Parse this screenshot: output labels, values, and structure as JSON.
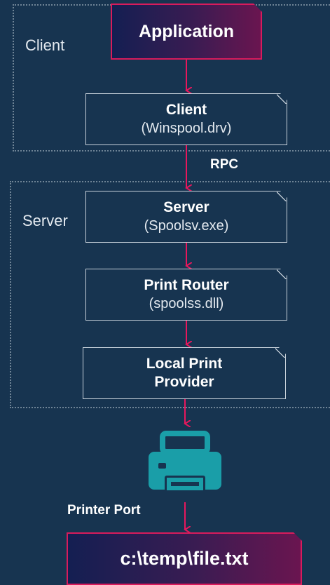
{
  "regions": {
    "client_label": "Client",
    "server_label": "Server"
  },
  "nodes": {
    "application": {
      "title": "Application"
    },
    "client": {
      "title": "Client",
      "sub": "(Winspool.drv)"
    },
    "server": {
      "title": "Server",
      "sub": "(Spoolsv.exe)"
    },
    "router": {
      "title": "Print Router",
      "sub": "(spoolss.dll)"
    },
    "provider": {
      "title_line1": "Local Print",
      "title_line2": "Provider"
    },
    "file": {
      "title": "c:\\temp\\file.txt"
    }
  },
  "edges": {
    "rpc": "RPC",
    "printer_port": "Printer Port"
  },
  "icons": {
    "printer": "printer-icon"
  },
  "colors": {
    "background": "#173450",
    "arrow": "#e8175d",
    "printer": "#1a9ea8",
    "highlight_border": "#d91b5c"
  }
}
